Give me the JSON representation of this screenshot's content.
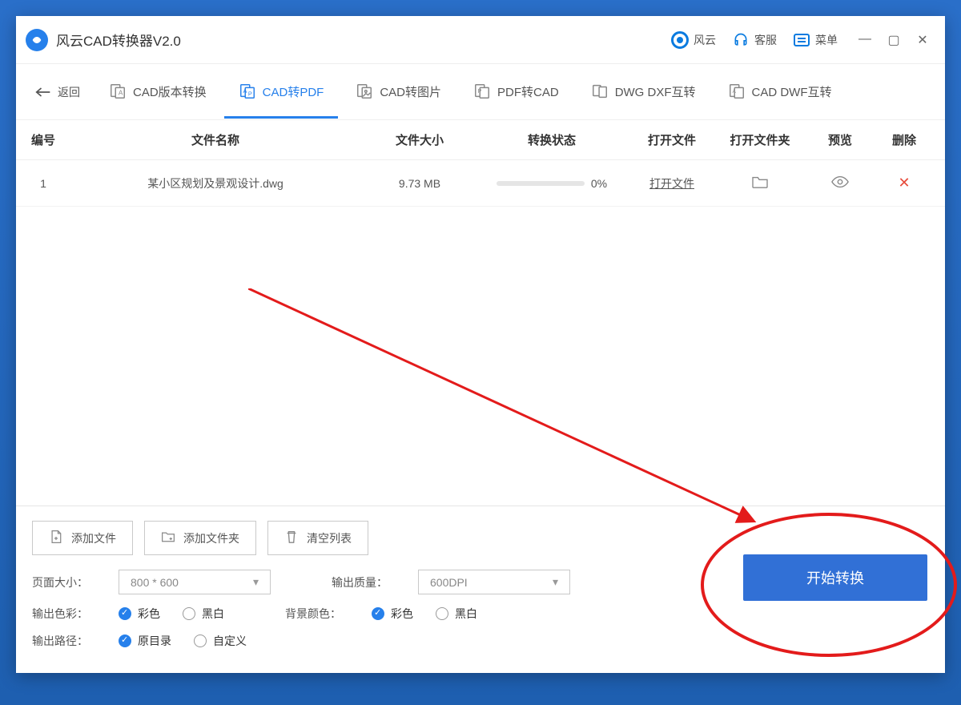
{
  "titlebar": {
    "app_title": "风云CAD转换器V2.0",
    "fengyun": "风云",
    "kefu": "客服",
    "menu": "菜单"
  },
  "tabs": {
    "back": "返回",
    "t0": "CAD版本转换",
    "t1": "CAD转PDF",
    "t2": "CAD转图片",
    "t3": "PDF转CAD",
    "t4": "DWG DXF互转",
    "t5": "CAD DWF互转"
  },
  "table": {
    "head": {
      "idx": "编号",
      "name": "文件名称",
      "size": "文件大小",
      "status": "转换状态",
      "open": "打开文件",
      "folder": "打开文件夹",
      "preview": "预览",
      "del": "删除"
    },
    "rows": [
      {
        "idx": "1",
        "name": "某小区规划及景观设计.dwg",
        "size": "9.73 MB",
        "percent": "0%",
        "open": "打开文件"
      }
    ]
  },
  "bottom": {
    "add_file": "添加文件",
    "add_folder": "添加文件夹",
    "clear_list": "清空列表",
    "page_size_label": "页面大小：",
    "page_size_value": "800 * 600",
    "quality_label": "输出质量：",
    "quality_value": "600DPI",
    "color_label": "输出色彩：",
    "color_opt1": "彩色",
    "color_opt2": "黑白",
    "bg_label": "背景颜色：",
    "bg_opt1": "彩色",
    "bg_opt2": "黑白",
    "path_label": "输出路径：",
    "path_opt1": "原目录",
    "path_opt2": "自定义",
    "start": "开始转换"
  }
}
